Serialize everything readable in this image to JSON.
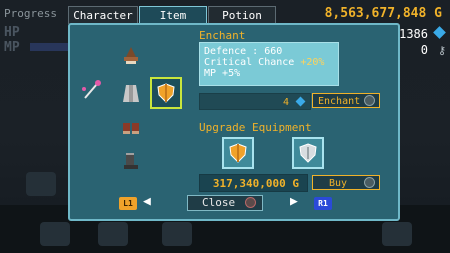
{
  "hud": {
    "progress_label": "Progress",
    "hp_label": "HP",
    "mp_label": "MP",
    "gold_total": "8,563,677,848 G",
    "gem_count": "1386",
    "key_count": "0"
  },
  "tabs": [
    {
      "label": "Character",
      "active": false
    },
    {
      "label": "Item",
      "active": true
    },
    {
      "label": "Potion",
      "active": false
    }
  ],
  "equipment": {
    "slots": [
      {
        "name": "head",
        "icon": "helmet-icon"
      },
      {
        "name": "weapon",
        "icon": "staff-icon"
      },
      {
        "name": "armor",
        "icon": "robe-icon"
      },
      {
        "name": "shield",
        "icon": "shield-icon",
        "selected": true
      },
      {
        "name": "gloves",
        "icon": "gloves-icon"
      },
      {
        "name": "boots",
        "icon": "boots-icon"
      }
    ]
  },
  "enchant": {
    "title": "Enchant",
    "stats": {
      "line1": "Defence : 660",
      "line2_label": "Critical Chance",
      "line2_value": "+20%",
      "line3": "MP +5%"
    },
    "cost": "4",
    "button_label": "Enchant"
  },
  "upgrade": {
    "title": "Upgrade Equipment",
    "cost": "317,340,000 G",
    "button_label": "Buy"
  },
  "controls": {
    "left_chip": "L1",
    "right_chip": "R1",
    "close_label": "Close"
  },
  "colors": {
    "panel": "#2a6372",
    "accent_gold": "#f0b22a",
    "selection": "#c9e63c",
    "gem": "#3aaae8"
  }
}
